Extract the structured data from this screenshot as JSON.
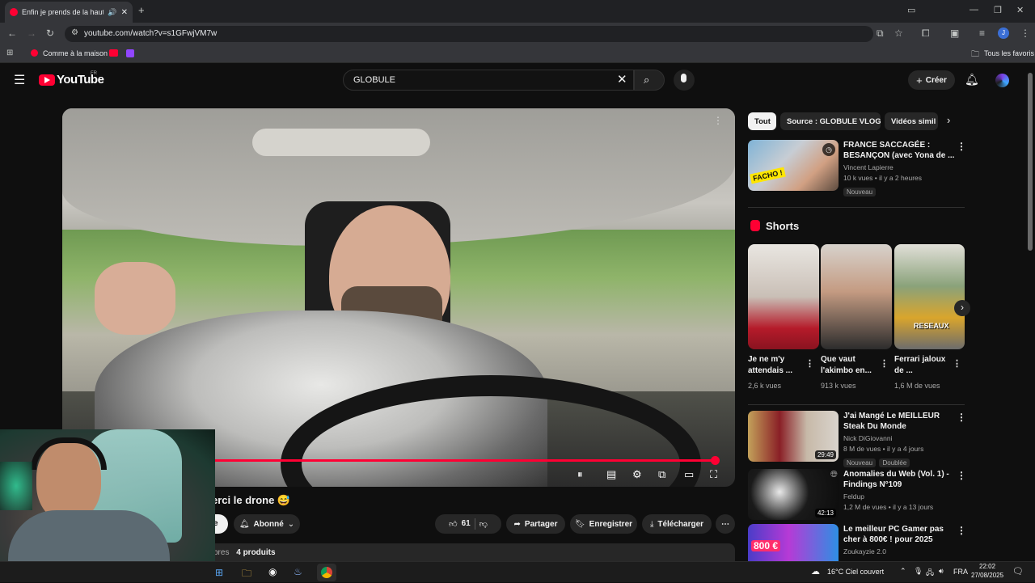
{
  "browser": {
    "tab_title": "Enfin je prends de la haute",
    "new_tab": "+",
    "url": "youtube.com/watch?v=s1GFwjVM7w",
    "bookmarks": [
      {
        "label": "Comme à la maison"
      }
    ],
    "all_bookmarks": "Tous les favoris",
    "profile_initial": "J"
  },
  "youtube": {
    "logo_text": "YouTube",
    "logo_region": "FR",
    "search_value": "GLOBULE",
    "create_label": "Créer"
  },
  "video": {
    "title_visible": "erci le drone 😅",
    "progress": 0.97,
    "subscribe_label": "e",
    "subscribed_label": "Abonné",
    "like_count": "61",
    "share_label": "Partager",
    "save_label": "Enregistrer",
    "download_label": "Télécharger",
    "members_label": "bres",
    "products_label": "4 produits"
  },
  "sidebar": {
    "chips": [
      "Tout",
      "Source : GLOBULE VLOGS",
      "Vidéos simil"
    ],
    "videos_top": [
      {
        "title": "FRANCE SACCAGÉE : BESANÇON (avec Yona de ...",
        "channel": "Vincent Lapierre",
        "meta": "10 k vues • il y a 2 heures",
        "badge": "Nouveau",
        "thumb_text": "FACHO !"
      }
    ],
    "shorts_title": "Shorts",
    "shorts": [
      {
        "title": "Je ne m'y attendais ...",
        "views": "2,6 k vues"
      },
      {
        "title": "Que vaut l'akimbo en...",
        "views": "913 k vues"
      },
      {
        "title": "Ferrari jaloux de ...",
        "views": "1,6 M de vues",
        "overlay": "RESEAUX"
      }
    ],
    "videos": [
      {
        "title": "J'ai Mangé Le MEILLEUR Steak Du Monde",
        "channel": "Nick DiGiovanni",
        "meta": "8 M de vues • il y a 4 jours",
        "badge": "Nouveau",
        "badge2": "Doublée",
        "duration": "29:49"
      },
      {
        "title": "Anomalies du Web (Vol. 1) - Findings N°109",
        "channel": "Feldup",
        "meta": "1,2 M de vues • il y a 13 jours",
        "duration": "42:13"
      },
      {
        "title": "Le meilleur PC Gamer pas cher à 800€ ! pour 2025",
        "channel": "Zoukayzie 2.0",
        "thumb_text": "800 €"
      }
    ]
  },
  "taskbar": {
    "weather": "16°C  Ciel couvert",
    "lang": "FRA",
    "time": "22:02",
    "date": "27/08/2025"
  }
}
